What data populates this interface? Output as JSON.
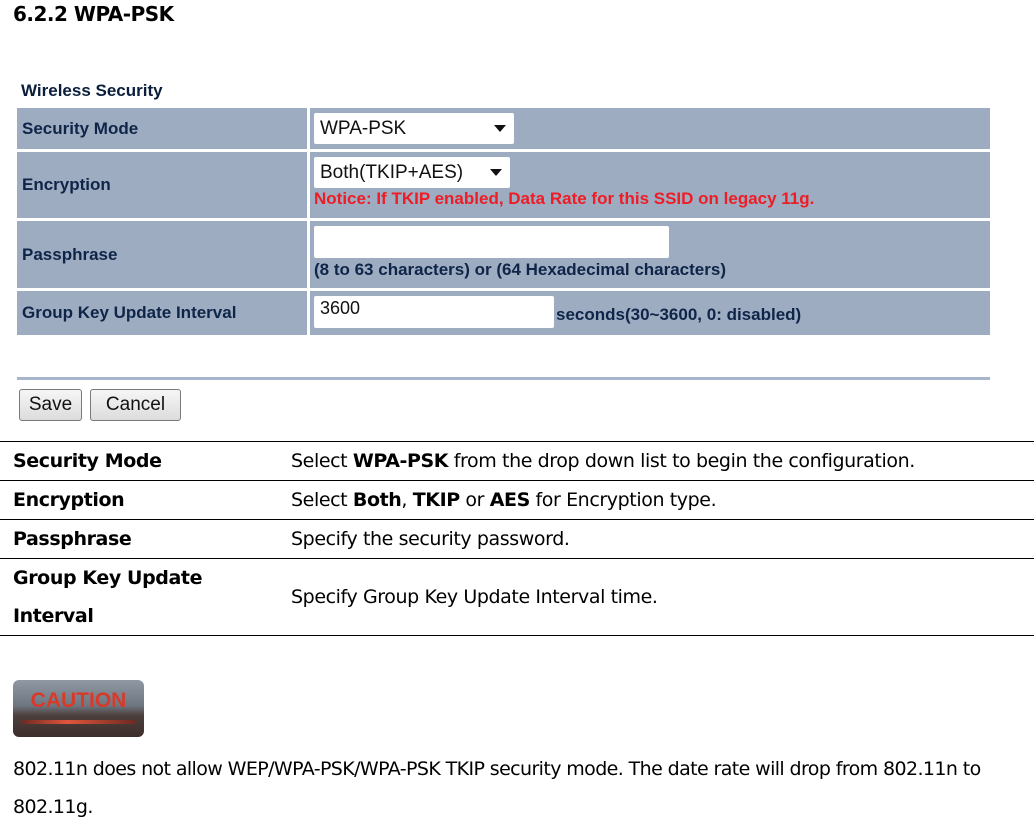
{
  "heading": "6.2.2 WPA-PSK",
  "wireless_security": {
    "title": "Wireless Security",
    "rows": {
      "security_mode": {
        "label": "Security Mode",
        "selected": "WPA-PSK"
      },
      "encryption": {
        "label": "Encryption",
        "selected": "Both(TKIP+AES)",
        "notice": "Notice: If TKIP enabled, Data Rate for this SSID on legacy 11g."
      },
      "passphrase": {
        "label": "Passphrase",
        "value": "",
        "hint": "(8 to 63 characters) or (64 Hexadecimal characters)"
      },
      "group_key": {
        "label": "Group Key Update Interval",
        "value": "3600",
        "unit": "seconds(30~3600, 0: disabled)"
      }
    },
    "buttons": {
      "save": "Save",
      "cancel": "Cancel"
    },
    "colors": {
      "row_bg": "#9eacc2",
      "label_text": "#0e2548",
      "notice": "#ee1c25"
    }
  },
  "doc_table": {
    "rows": [
      {
        "key": "Security Mode",
        "value_parts": [
          "Select ",
          "WPA-PSK",
          " from the drop down list to begin the configuration."
        ]
      },
      {
        "key": "Encryption",
        "value_parts": [
          "Select ",
          "Both",
          ", ",
          "TKIP",
          " or ",
          "AES",
          " for Encryption type."
        ]
      },
      {
        "key": "Passphrase",
        "value": "Specify the security password."
      },
      {
        "key_line1": "Group Key Update",
        "key_line2": "Interval",
        "value": "Specify Group Key Update Interval time."
      }
    ]
  },
  "caution": {
    "icon_text": "CAUTION",
    "text": "802.11n does not allow WEP/WPA-PSK/WPA-PSK TKIP security mode. The date rate will drop from 802.11n to 802.11g."
  }
}
